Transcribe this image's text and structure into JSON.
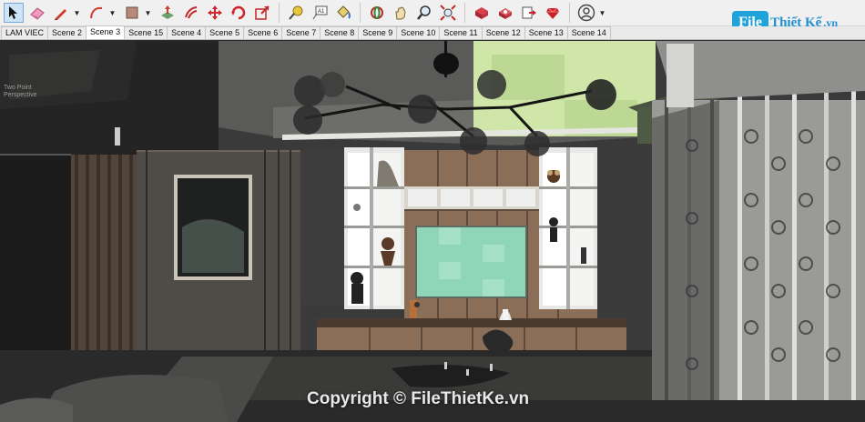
{
  "toolbar": {
    "tools": [
      {
        "icon": "select-arrow-icon",
        "selected": true
      },
      {
        "icon": "eraser-icon"
      },
      {
        "icon": "pencil-line-icon",
        "dropdown": true
      },
      {
        "icon": "arc-icon",
        "dropdown": true
      },
      {
        "icon": "rectangle-shape-icon",
        "dropdown": true
      },
      {
        "icon": "push-pull-icon"
      },
      {
        "icon": "offset-icon"
      },
      {
        "icon": "move-icon"
      },
      {
        "icon": "rotate-icon"
      },
      {
        "icon": "scale-icon"
      },
      {
        "icon": "tape-measure-icon"
      },
      {
        "icon": "text-label-icon"
      },
      {
        "icon": "paint-bucket-icon"
      },
      {
        "icon": "orbit-icon"
      },
      {
        "icon": "pan-hand-icon"
      },
      {
        "icon": "zoom-icon"
      },
      {
        "icon": "zoom-extents-icon"
      },
      {
        "icon": "warehouse-icon"
      },
      {
        "icon": "extension-warehouse-icon"
      },
      {
        "icon": "send-to-layout-icon"
      },
      {
        "icon": "ruby-console-icon"
      },
      {
        "icon": "account-icon",
        "dropdown": true
      }
    ]
  },
  "logo": {
    "badge": "File",
    "text": "Thiết Kế",
    "suffix": ".vn"
  },
  "scene_tabs": [
    {
      "label": "LAM VIEC",
      "active": false
    },
    {
      "label": "Scene 2",
      "active": false
    },
    {
      "label": "Scene 3",
      "active": true
    },
    {
      "label": "Scene 15",
      "active": false
    },
    {
      "label": "Scene 4",
      "active": false
    },
    {
      "label": "Scene 5",
      "active": false
    },
    {
      "label": "Scene 6",
      "active": false
    },
    {
      "label": "Scene 7",
      "active": false
    },
    {
      "label": "Scene 8",
      "active": false
    },
    {
      "label": "Scene 9",
      "active": false
    },
    {
      "label": "Scene 10",
      "active": false
    },
    {
      "label": "Scene 11",
      "active": false
    },
    {
      "label": "Scene 12",
      "active": false
    },
    {
      "label": "Scene 13",
      "active": false
    },
    {
      "label": "Scene 14",
      "active": false
    }
  ],
  "viewport": {
    "camera_label": "Two Point\nPerspective",
    "copyright": "Copyright © FileThietKe.vn"
  },
  "colors": {
    "accent": "#1fa3d8",
    "tv_screen": "#8fd6b8",
    "ceiling_light_green": "#cfe6a8",
    "wood": "#8a6e58"
  }
}
